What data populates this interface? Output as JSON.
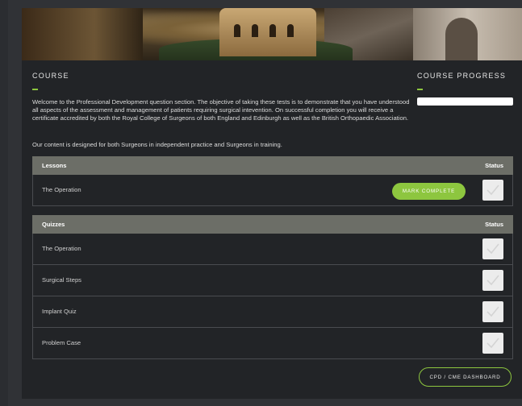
{
  "course": {
    "title": "COURSE",
    "intro": "Welcome to the Professional Development question section. The objective of taking these tests is to demonstrate that you have understood all aspects of the assessment and management of patients requiring surgical intevention. On successful completion you will receive a certificate accredited by both the Royal College of Surgeons of both England and Edinburgh as well as the British Orthopaedic Association.",
    "content_note": "Our content is designed for both Surgeons in independent practice and Surgeons in training."
  },
  "progress": {
    "title": "COURSE PROGRESS",
    "percent": 0
  },
  "lessons": {
    "header": "Lessons",
    "status_header": "Status",
    "items": [
      {
        "name": "The Operation",
        "button": "MARK COMPLETE",
        "complete": false
      }
    ]
  },
  "quizzes": {
    "header": "Quizzes",
    "status_header": "Status",
    "items": [
      {
        "name": "The Operation",
        "complete": false
      },
      {
        "name": "Surgical Steps",
        "complete": false
      },
      {
        "name": "Implant Quiz",
        "complete": false
      },
      {
        "name": "Problem Case",
        "complete": false
      }
    ]
  },
  "dashboard_button": "CPD / CME DASHBOARD",
  "colors": {
    "accent": "#8dc63f",
    "panel": "#222427",
    "table_header": "#6c6e67"
  },
  "icons": {
    "status": "checkmark-icon"
  }
}
